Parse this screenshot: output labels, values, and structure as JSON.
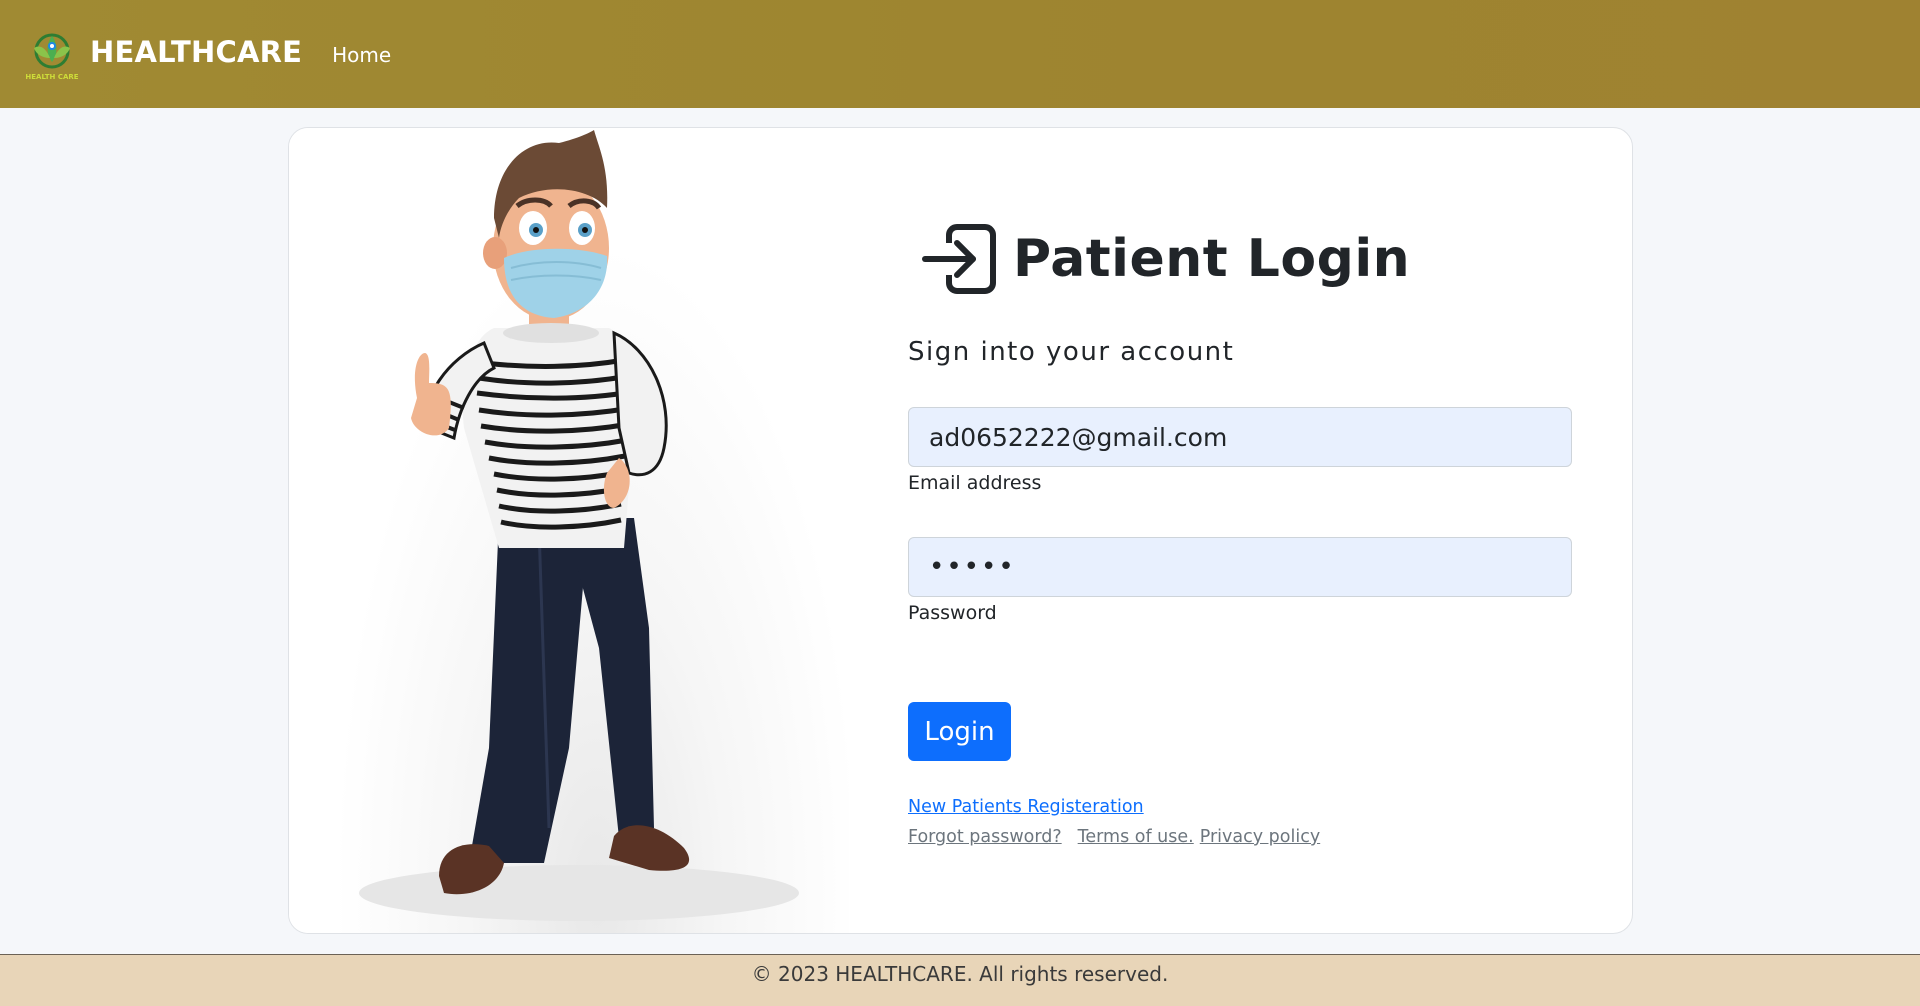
{
  "navbar": {
    "brand": "HEALTHCARE",
    "logo_text": "HEALTH CARE",
    "home_label": "Home",
    "bg_color": "#9f8631"
  },
  "login": {
    "title": "Patient Login",
    "title_icon": "box-arrow-in-right-icon",
    "subtitle": "Sign into your account",
    "email_value": "ad0652222@gmail.com",
    "email_label": "Email address",
    "password_value": "•••••",
    "password_label": "Password",
    "login_button": "Login",
    "register_link": "New Patients Registeration",
    "forgot_link": "Forgot password?",
    "terms_link": "Terms of use.",
    "privacy_link": "Privacy policy",
    "accent_color": "#0d6efd"
  },
  "footer": {
    "text": "© 2023 HEALTHCARE. All rights reserved."
  }
}
